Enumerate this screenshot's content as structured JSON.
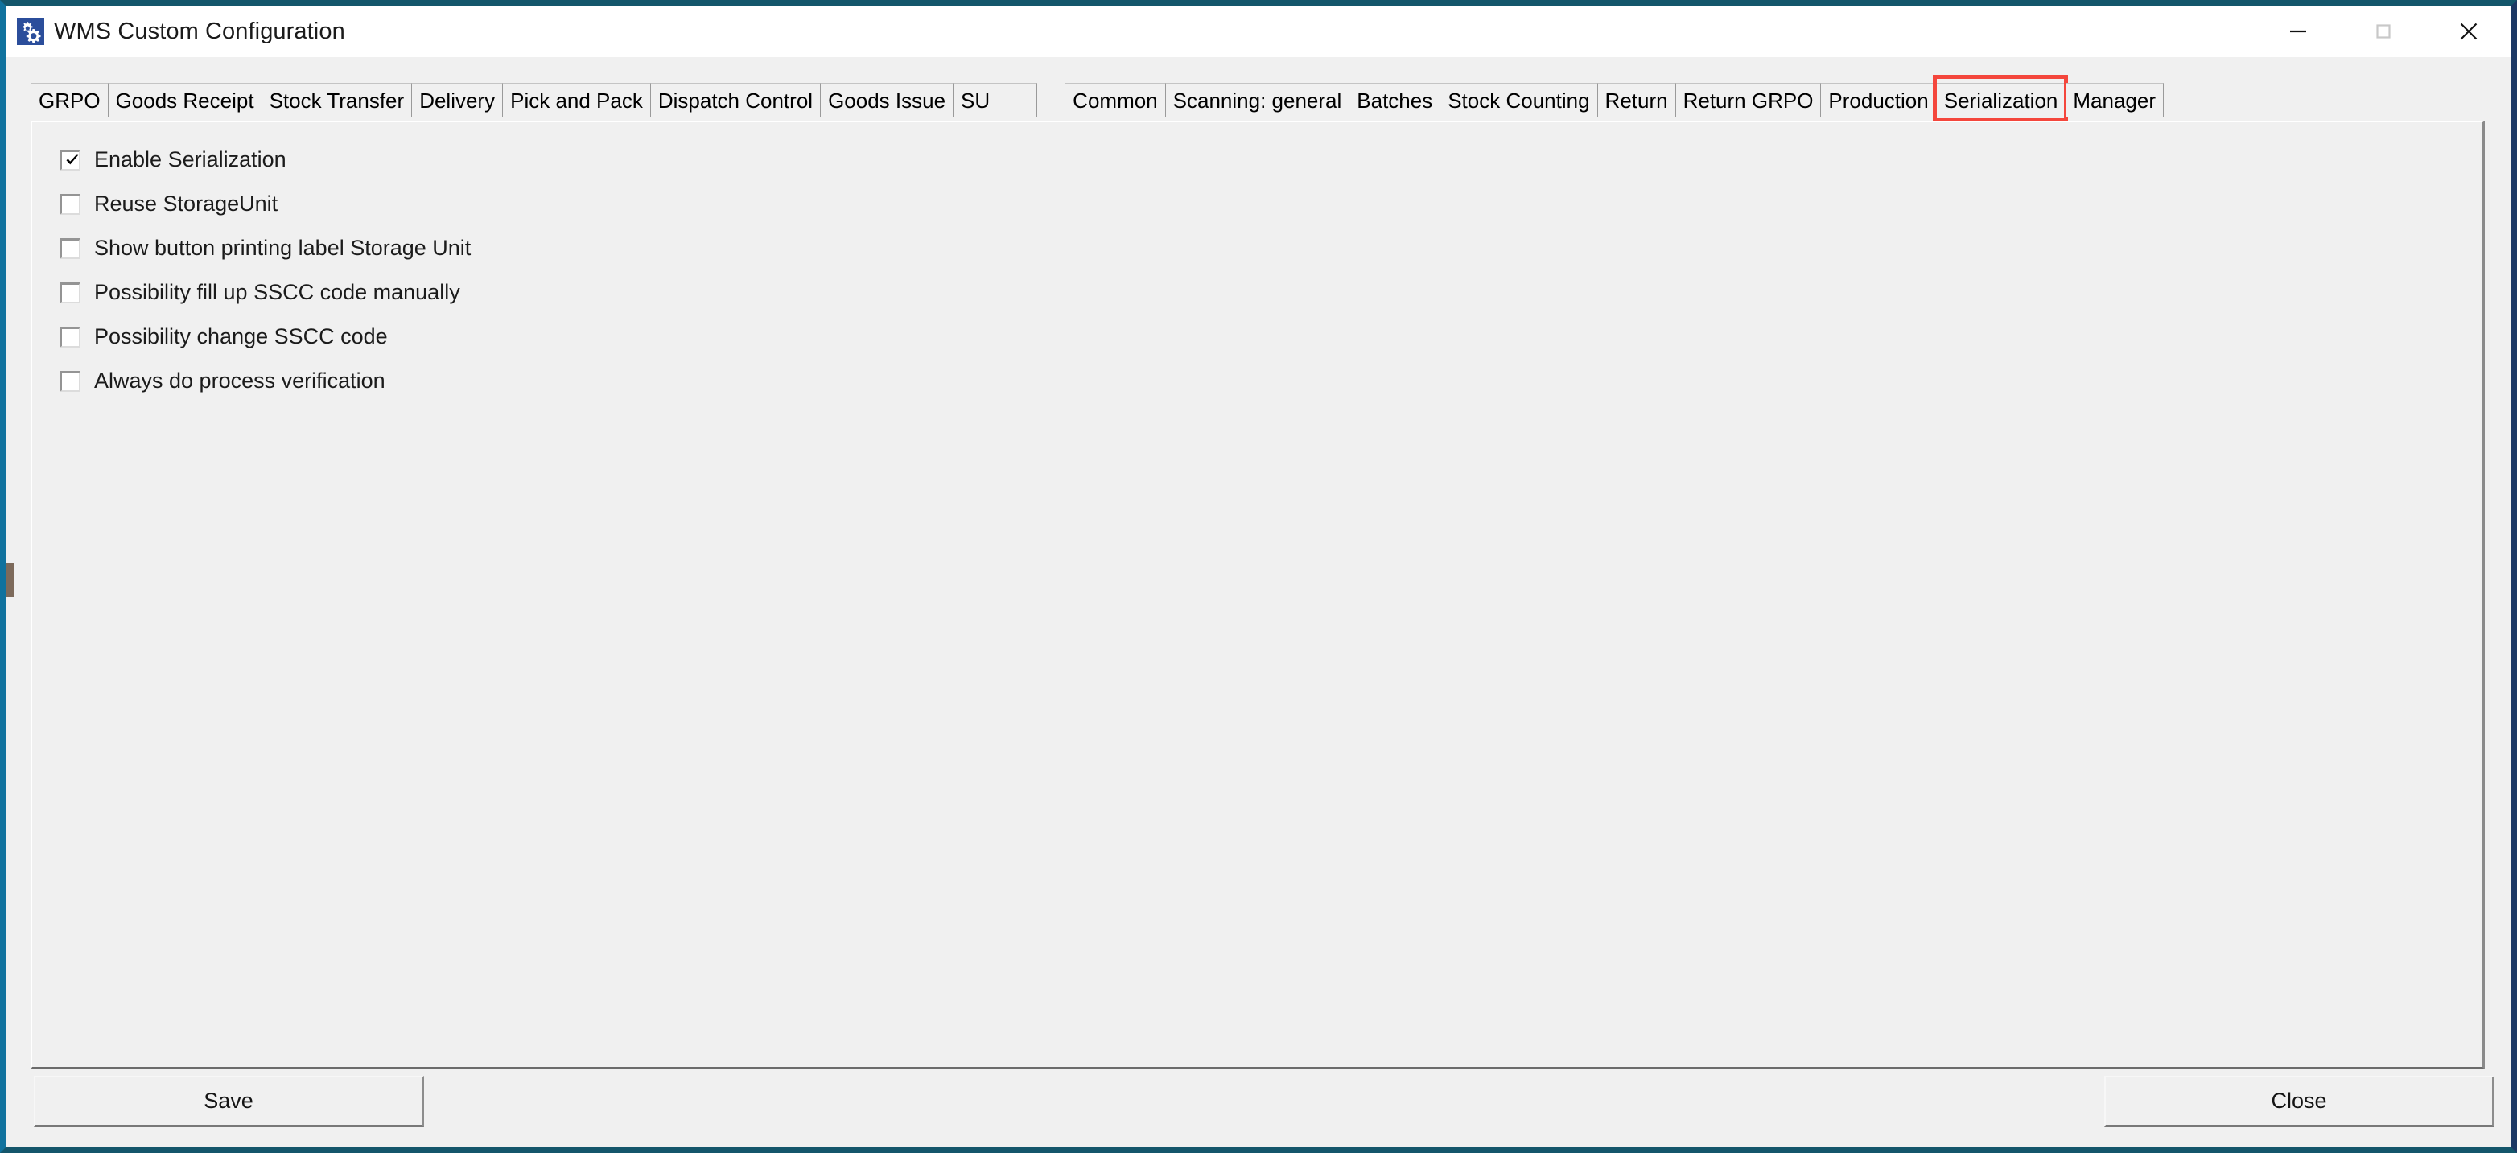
{
  "window": {
    "title": "WMS Custom Configuration",
    "app_icon": "gears-icon",
    "controls": {
      "minimize": "minimize-icon",
      "maximize": "maximize-icon",
      "close": "close-icon"
    },
    "accent_colors": {
      "border_top": "#14566b",
      "border_left": "#10729e",
      "border_right": "#1c3864",
      "dialog_background": "#f0f0f0",
      "titlebar_background": "#ffffff",
      "highlight_red": "#f4463c"
    }
  },
  "tabs": [
    {
      "label": "GRPO",
      "selected": false,
      "highlighted": false
    },
    {
      "label": "Goods Receipt",
      "selected": false,
      "highlighted": false
    },
    {
      "label": "Stock Transfer",
      "selected": false,
      "highlighted": false
    },
    {
      "label": "Delivery",
      "selected": false,
      "highlighted": false
    },
    {
      "label": "Pick and Pack",
      "selected": false,
      "highlighted": false
    },
    {
      "label": "Dispatch Control",
      "selected": false,
      "highlighted": false
    },
    {
      "label": "Goods Issue",
      "selected": false,
      "highlighted": false
    },
    {
      "label": "SU",
      "selected": false,
      "highlighted": false
    },
    {
      "label": "Common",
      "selected": false,
      "highlighted": false
    },
    {
      "label": "Scanning: general",
      "selected": false,
      "highlighted": false
    },
    {
      "label": "Batches",
      "selected": false,
      "highlighted": false
    },
    {
      "label": "Stock Counting",
      "selected": false,
      "highlighted": false
    },
    {
      "label": "Return",
      "selected": false,
      "highlighted": false
    },
    {
      "label": "Return GRPO",
      "selected": false,
      "highlighted": false
    },
    {
      "label": "Production",
      "selected": false,
      "highlighted": false
    },
    {
      "label": "Serialization",
      "selected": true,
      "highlighted": true
    },
    {
      "label": "Manager",
      "selected": false,
      "highlighted": false
    }
  ],
  "content": {
    "active_tab": "Serialization",
    "checkboxes": [
      {
        "label": "Enable Serialization",
        "checked": true
      },
      {
        "label": "Reuse StorageUnit",
        "checked": false
      },
      {
        "label": "Show button printing label Storage Unit",
        "checked": false
      },
      {
        "label": "Possibility fill up SSCC code manually",
        "checked": false
      },
      {
        "label": "Possibility change SSCC code",
        "checked": false
      },
      {
        "label": "Always do process verification",
        "checked": false
      }
    ]
  },
  "footer": {
    "save_label": "Save",
    "close_label": "Close"
  }
}
